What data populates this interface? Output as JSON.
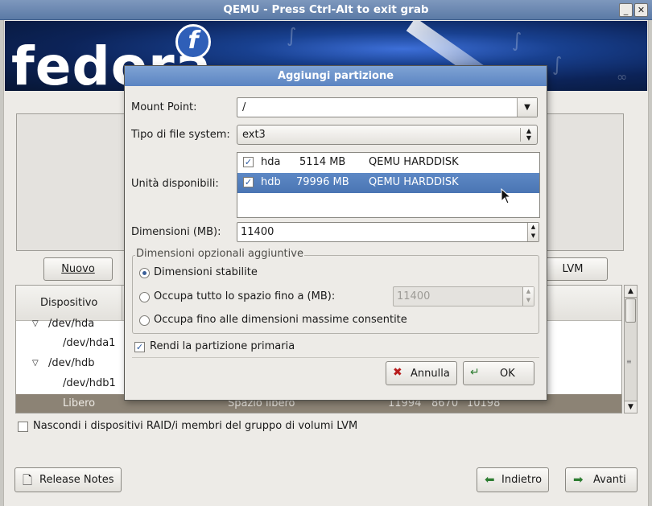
{
  "window": {
    "title": "QEMU - Press Ctrl-Alt to exit grab",
    "minimize_glyph": "_",
    "close_glyph": "✕"
  },
  "banner": {
    "wordmark": "fedora",
    "logo_glyph": "f"
  },
  "background": {
    "buttons": {
      "new": "Nuovo",
      "lvm": "LVM"
    },
    "tree": {
      "column_header": "Dispositivo",
      "rows": [
        {
          "expander": "▽",
          "label": "/dev/hda"
        },
        {
          "label": "/dev/hda1"
        },
        {
          "expander": "▽",
          "label": "/dev/hdb"
        },
        {
          "label": "/dev/hdb1"
        },
        {
          "label": "Libero",
          "type": "Spazio libero",
          "size": "11994",
          "start": "8670",
          "end": "10198",
          "selected": true
        }
      ]
    },
    "hide_raid": {
      "label": "Nascondi i dispositivi RAID/i membri del gruppo di volumi LVM",
      "checked": false
    },
    "release_notes": "Release Notes",
    "back": "Indietro",
    "next": "Avanti"
  },
  "dialog": {
    "title": "Aggiungi partizione",
    "mount_point": {
      "label": "Mount Point:",
      "value": "/"
    },
    "fs_type": {
      "label": "Tipo di file system:",
      "value": "ext3"
    },
    "drives": {
      "label": "Unità disponibili:",
      "rows": [
        {
          "checked": true,
          "name": "hda",
          "size": "5114 MB",
          "model": "QEMU HARDDISK",
          "selected": false
        },
        {
          "checked": true,
          "name": "hdb",
          "size": "79996 MB",
          "model": "QEMU HARDDISK",
          "selected": true
        }
      ]
    },
    "size": {
      "label": "Dimensioni (MB):",
      "value": "11400"
    },
    "options": {
      "legend": "Dimensioni opzionali aggiuntive",
      "fixed": "Dimensioni stabilite",
      "fill_to": "Occupa tutto lo spazio fino a (MB):",
      "fill_to_value": "11400",
      "fill_max": "Occupa fino alle dimensioni massime consentite",
      "selected": "fixed"
    },
    "primary": {
      "label": "Rendi la partizione primaria",
      "checked": true
    },
    "cancel": "Annulla",
    "ok": "OK"
  },
  "colors": {
    "titlebar": "#5b7aa6",
    "dialog_title": "#5b84c2",
    "selection": "#4a75b3",
    "tree_selection": "#8c8375"
  }
}
